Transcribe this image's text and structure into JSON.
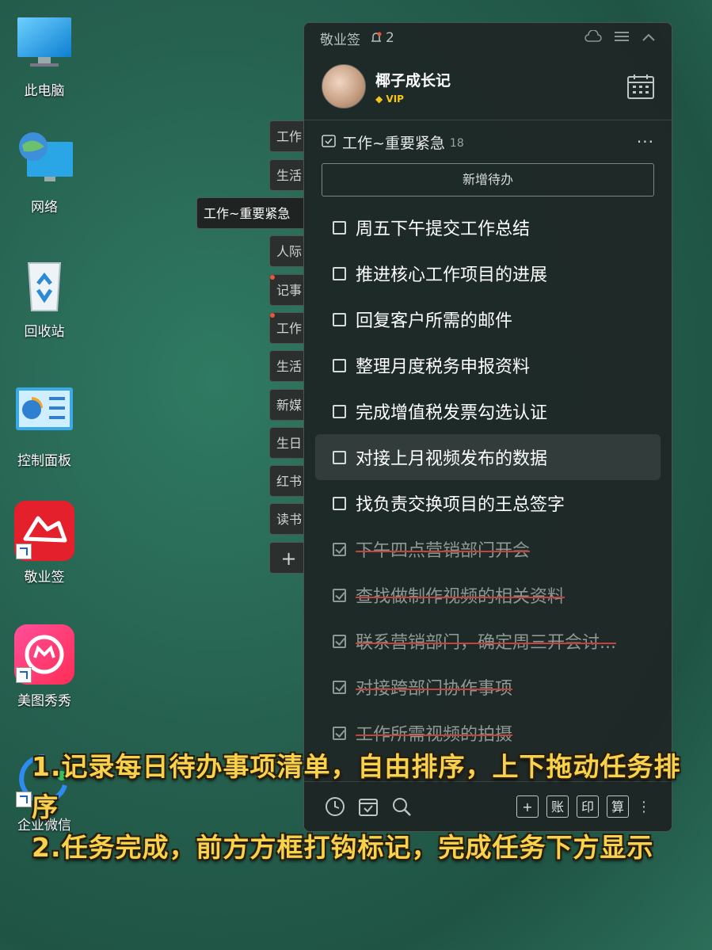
{
  "desktop": {
    "icons": [
      {
        "label": "此电脑",
        "icon": "computer-icon"
      },
      {
        "label": "网络",
        "icon": "network-icon"
      },
      {
        "label": "回收站",
        "icon": "recycle-bin-icon"
      },
      {
        "label": "控制面板",
        "icon": "control-panel-icon"
      },
      {
        "label": "敬业签",
        "icon": "jingyeqian-app-icon"
      },
      {
        "label": "美图秀秀",
        "icon": "meitu-app-icon"
      },
      {
        "label": "企业微信",
        "icon": "wecom-app-icon"
      }
    ]
  },
  "side_tabs": [
    "工作",
    "生活",
    "工作~重要紧急",
    "人际",
    "记事",
    "工作",
    "生活",
    "新媒",
    "生日",
    "红书",
    "读书",
    "+"
  ],
  "widget": {
    "app_name": "敬业签",
    "notification_count": "2",
    "profile": {
      "name": "椰子成长记",
      "badge": "VIP"
    },
    "list": {
      "title": "工作~重要紧急",
      "count": "18",
      "more": "···",
      "add_label": "新增待办",
      "tasks": [
        {
          "text": "周五下午提交工作总结",
          "done": false
        },
        {
          "text": "推进核心工作项目的进展",
          "done": false
        },
        {
          "text": "回复客户所需的邮件",
          "done": false
        },
        {
          "text": "整理月度税务申报资料",
          "done": false
        },
        {
          "text": "完成增值税发票勾选认证",
          "done": false
        },
        {
          "text": "对接上月视频发布的数据",
          "done": false,
          "highlighted": true
        },
        {
          "text": "找负责交换项目的王总签字",
          "done": false
        },
        {
          "text": "下午四点营销部门开会",
          "done": true
        },
        {
          "text": "查找做制作视频的相关资料",
          "done": true
        },
        {
          "text": "联系营销部门，确定周三开会讨...",
          "done": true
        },
        {
          "text": "对接跨部门协作事项",
          "done": true
        },
        {
          "text": "工作所需视频的拍摄",
          "done": true
        }
      ]
    },
    "bottom_buttons": [
      "+",
      "账",
      "印",
      "算"
    ]
  },
  "caption": {
    "line1": "1.记录每日待办事项清单，自由排序，上下拖动任务排序",
    "line2": "2.任务完成，前方方框打钩标记，完成任务下方显示"
  },
  "colors": {
    "accent_yellow": "#f7d24a",
    "strike_red": "#c2433a",
    "vip_gold": "#f5c518"
  }
}
